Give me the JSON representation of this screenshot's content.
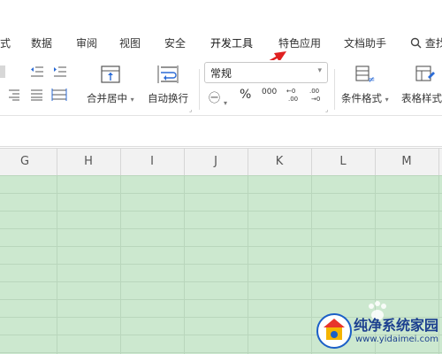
{
  "ribbon_tabs": [
    {
      "label": "式"
    },
    {
      "label": "数据"
    },
    {
      "label": "审阅"
    },
    {
      "label": "视图"
    },
    {
      "label": "安全"
    },
    {
      "label": "开发工具"
    },
    {
      "label": "特色应用"
    },
    {
      "label": "文档助手"
    },
    {
      "label": "查找"
    }
  ],
  "toolbar": {
    "merge_center": "合并居中",
    "wrap_text": "自动换行",
    "number_format": "常规",
    "percent_symbol": "%",
    "thousands_symbol": "000",
    "conditional_format": "条件格式",
    "table_style": "表格样式"
  },
  "columns": [
    "G",
    "H",
    "I",
    "J",
    "K",
    "L",
    "M"
  ],
  "watermark": {
    "title": "纯净系统家园",
    "url": "www.yidaimei.com"
  },
  "colors": {
    "grid_bg": "#cce8cf",
    "arrow": "#e02020",
    "header_bg": "#f2f2f2"
  }
}
